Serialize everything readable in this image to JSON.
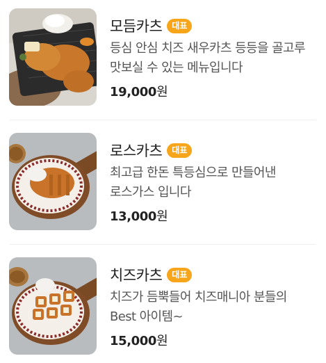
{
  "menu": {
    "items": [
      {
        "name": "모듬카츠",
        "badge": "대표",
        "description": "등심 안심 치즈 새우카츠 등등을 골고루 맛보실 수 있는 메뉴입니다",
        "price_amount": "19,000",
        "price_unit": "원",
        "image": "assorted-katsu-photo"
      },
      {
        "name": "로스카츠",
        "badge": "대표",
        "description": "최고급 한돈 특등심으로 만들어낸 로스가스 입니다",
        "price_amount": "13,000",
        "price_unit": "원",
        "image": "loin-katsu-photo"
      },
      {
        "name": "치즈카츠",
        "badge": "대표",
        "description": "치즈가 듬뿍들어 치즈매니아 분들의 Best 아이템~",
        "price_amount": "15,000",
        "price_unit": "원",
        "image": "cheese-katsu-photo"
      }
    ]
  },
  "colors": {
    "badge": "#f7a51b",
    "text": "#222222",
    "description": "#555555",
    "divider": "#eeeeee"
  }
}
